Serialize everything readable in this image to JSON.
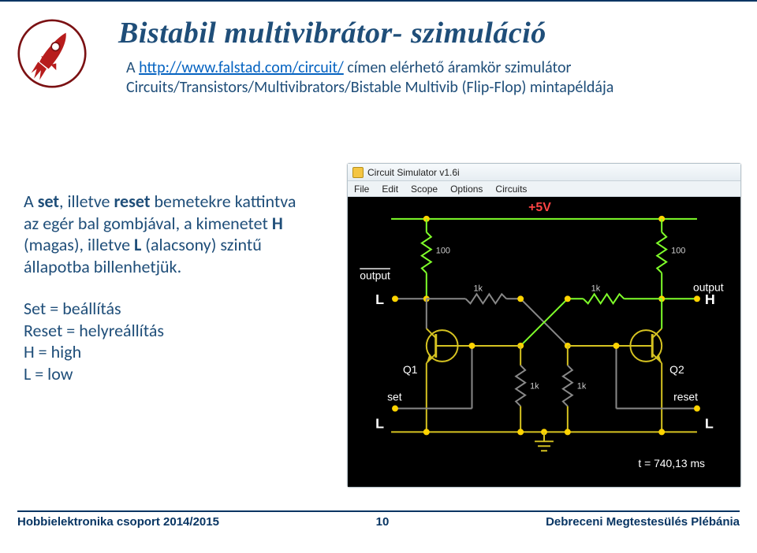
{
  "title": "Bistabil multivibrátor- szimuláció",
  "intro": {
    "pre": "A ",
    "link": "http://www.falstad.com/circuit/",
    "post": " címen elérhető áramkör szimulátor Circuits/Transistors/Multivibrators/Bistable Multivib (Flip-Flop) mintapéldája"
  },
  "para1": {
    "t1": "A ",
    "b1": "set",
    "t2": ", illetve ",
    "b2": "reset",
    "t3": " bemetekre kattintva az egér bal gombjával, a kimenetet ",
    "b3": "H",
    "t4": " (magas), illetve ",
    "b4": "L",
    "t5": " (alacsony) szintű állapotba billenhetjük."
  },
  "defs": {
    "l1": "Set = beállítás",
    "l2": "Reset = helyreállítás",
    "l3": "H = high",
    "l4": "L = low"
  },
  "sim": {
    "title": "Circuit Simulator v1.6i",
    "menu": [
      "File",
      "Edit",
      "Scope",
      "Options",
      "Circuits"
    ],
    "v5": "+5V",
    "r100a": "100",
    "r100b": "100",
    "r1ka": "1k",
    "r1kb": "1k",
    "r1kc": "1k",
    "r1kd": "1k",
    "out1": "output",
    "out2": "output",
    "L1": "L",
    "H1": "H",
    "L2": "L",
    "L3": "L",
    "q1": "Q1",
    "q2": "Q2",
    "setlbl": "set",
    "resetlbl": "reset",
    "time": "t = 740,13 ms"
  },
  "footer": {
    "left": "Hobbielektronika csoport 2014/2015",
    "page": "10",
    "right": "Debreceni Megtestesülés Plébánia"
  }
}
